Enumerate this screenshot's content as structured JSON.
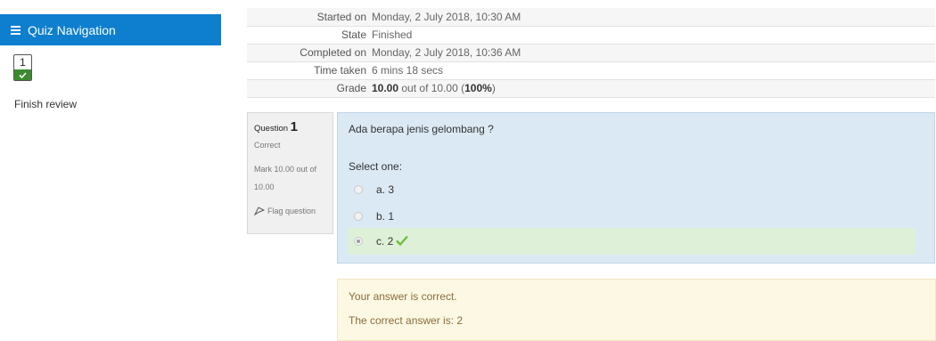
{
  "nav": {
    "title": "Quiz Navigation",
    "question_button": "1",
    "finish_review": "Finish review"
  },
  "summary": {
    "rows": [
      {
        "label": "Started on",
        "value": "Monday, 2 July 2018, 10:30 AM"
      },
      {
        "label": "State",
        "value": "Finished"
      },
      {
        "label": "Completed on",
        "value": "Monday, 2 July 2018, 10:36 AM"
      },
      {
        "label": "Time taken",
        "value": "6 mins 18 secs"
      }
    ],
    "grade": {
      "label": "Grade",
      "score": "10.00",
      "out_of": "out of 10.00",
      "percent_open": "(",
      "percent": "100%",
      "percent_close": ")"
    }
  },
  "question": {
    "title": "Question",
    "number": "1",
    "state": "Correct",
    "mark_line1": "Mark 10.00 out of",
    "mark_line2": "10.00",
    "flag_label": "Flag question",
    "text": "Ada berapa jenis gelombang ?",
    "prompt": "Select one:",
    "answers": [
      {
        "label": "a. 3",
        "checked": false,
        "correct": false
      },
      {
        "label": "b. 1",
        "checked": false,
        "correct": false
      },
      {
        "label": "c. 2",
        "checked": true,
        "correct": true
      }
    ]
  },
  "feedback": {
    "line1": "Your answer is correct.",
    "line2": "The correct answer is: 2"
  },
  "colors": {
    "nav_header": "#0e7fcf",
    "correct_green": "#3c8a2e",
    "question_bg": "#dbe9f4",
    "correct_answer_bg": "#dff0d8",
    "feedback_bg": "#fcf8e3"
  },
  "icons": {
    "menu": "menu-icon",
    "check": "check-icon",
    "flag": "flag-icon"
  }
}
